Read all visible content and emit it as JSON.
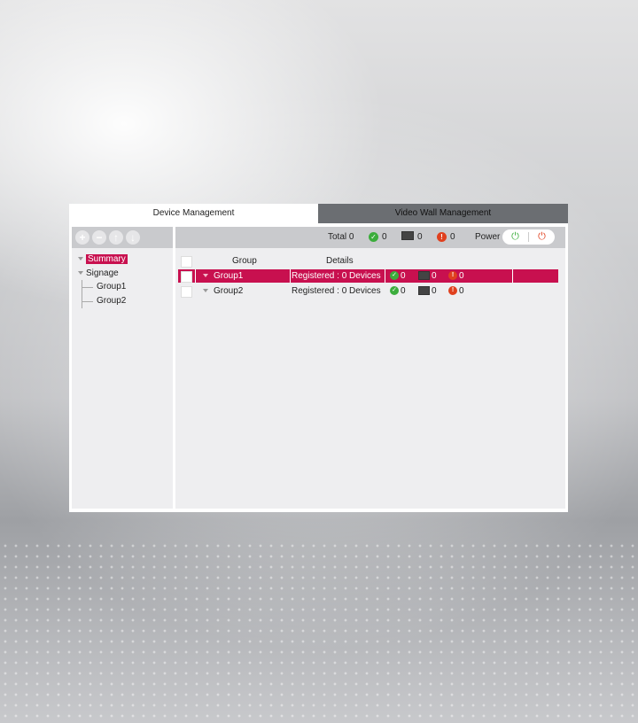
{
  "tabs": [
    {
      "label": "Device Management"
    },
    {
      "label": "Video Wall Management"
    }
  ],
  "left_toolbar": {
    "buttons": [
      {
        "icon": "plus-icon",
        "glyph": "+"
      },
      {
        "icon": "minus-icon",
        "glyph": "−"
      },
      {
        "icon": "arrow-up-icon",
        "glyph": "↑"
      },
      {
        "icon": "arrow-down-icon",
        "glyph": "↓"
      }
    ]
  },
  "tree": {
    "summary": "Summary",
    "signage": "Signage",
    "groups": [
      "Group1",
      "Group2"
    ]
  },
  "status": {
    "total_label": "Total",
    "total": "0",
    "ok": "0",
    "monitor": "0",
    "error": "0",
    "power_label": "Power"
  },
  "table": {
    "headers": {
      "group": "Group",
      "details": "Details"
    },
    "rows": [
      {
        "group": "Group1",
        "details": "Registered : 0 Devices",
        "ok": "0",
        "monitor": "0",
        "error": "0",
        "selected": true
      },
      {
        "group": "Group2",
        "details": "Registered : 0 Devices",
        "ok": "0",
        "monitor": "0",
        "error": "0",
        "selected": false
      }
    ]
  },
  "colors": {
    "accent": "#c8104f",
    "ok": "#3cad3c",
    "error": "#e0401e",
    "tab_inactive": "#6b6e72"
  }
}
